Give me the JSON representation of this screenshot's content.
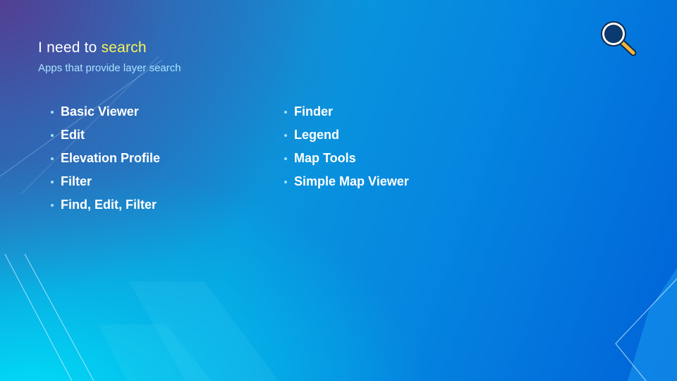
{
  "slide": {
    "title_prefix": "I need to ",
    "title_highlight": "search",
    "subtitle": "Apps that provide layer search",
    "icon": "search-icon",
    "colors": {
      "highlight": "#f3f55a",
      "subtitle": "#a9e4ff",
      "icon_lens": "#0b3a70",
      "icon_handle": "#f2b43a"
    }
  },
  "apps": {
    "left": [
      {
        "label": "Basic Viewer"
      },
      {
        "label": "Edit"
      },
      {
        "label": "Elevation Profile"
      },
      {
        "label": "Filter"
      },
      {
        "label": "Find, Edit, Filter"
      }
    ],
    "right": [
      {
        "label": "Finder"
      },
      {
        "label": "Legend"
      },
      {
        "label": "Map Tools"
      },
      {
        "label": "Simple Map Viewer"
      }
    ]
  }
}
